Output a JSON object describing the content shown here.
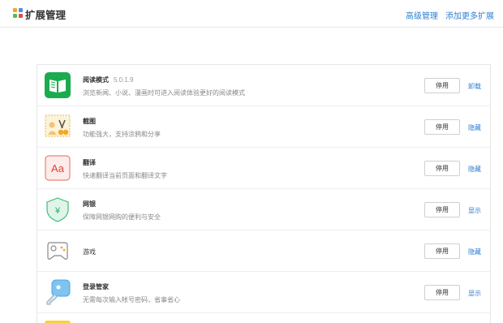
{
  "header": {
    "title": "扩展管理",
    "advanced_link": "高级管理",
    "add_more_link": "添加更多扩展"
  },
  "extensions": [
    {
      "name": "阅读模式",
      "version": "5.0.1.9",
      "desc": "浏览新闻、小说、漫画时可进入阅读体验更好的阅读模式",
      "button": "停用",
      "action": "卸载",
      "icon": "book-icon"
    },
    {
      "name": "截图",
      "version": "",
      "desc": "功能强大，支持涂鸦和分享",
      "button": "停用",
      "action": "隐藏",
      "icon": "scissors-icon"
    },
    {
      "name": "翻译",
      "version": "",
      "desc": "快速翻译当前页面和翻译文字",
      "button": "停用",
      "action": "隐藏",
      "icon": "translate-icon"
    },
    {
      "name": "网银",
      "version": "",
      "desc": "保障网银网购的便利与安全",
      "button": "停用",
      "action": "显示",
      "icon": "shield-yen-icon"
    },
    {
      "name": "游戏",
      "version": "",
      "desc": "",
      "button": "停用",
      "action": "隐藏",
      "icon": "gamepad-icon"
    },
    {
      "name": "登录管家",
      "version": "",
      "desc": "无需每次输入帐号密码，省事省心",
      "button": "停用",
      "action": "显示",
      "icon": "key-icon"
    }
  ]
}
